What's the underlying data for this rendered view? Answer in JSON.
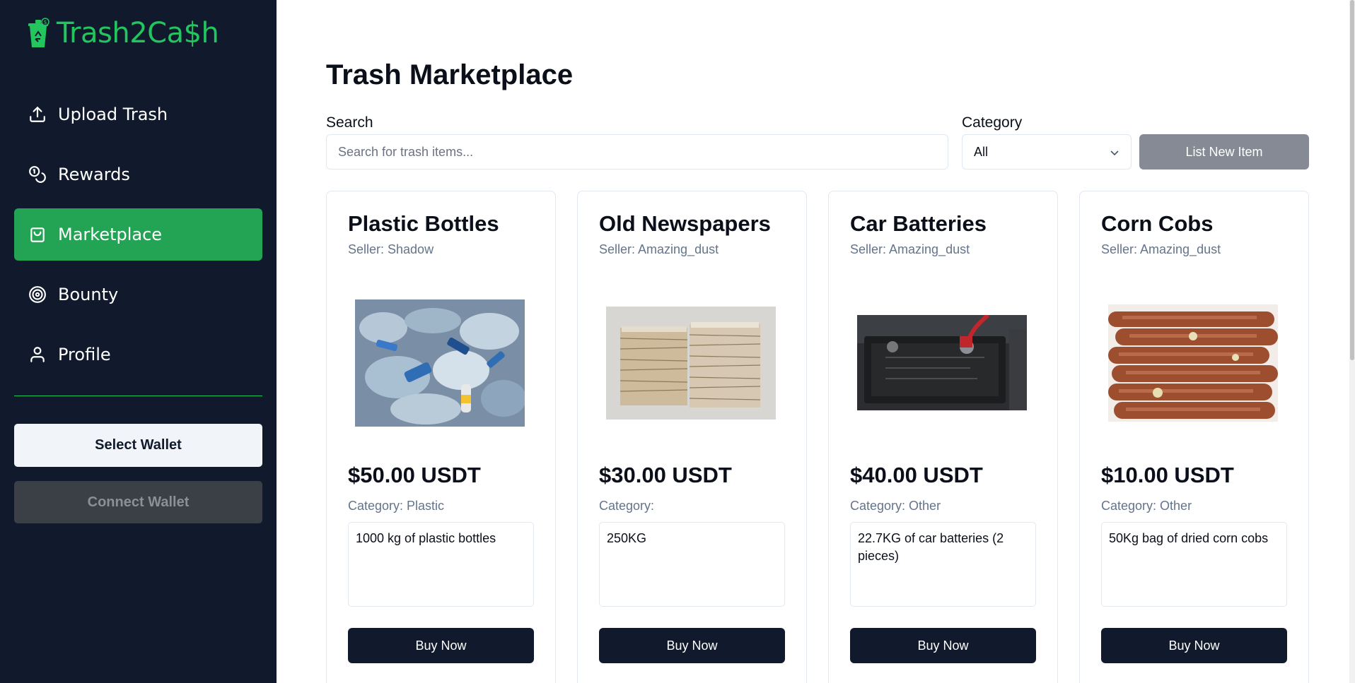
{
  "sidebar": {
    "brand": "Trash2Ca$h",
    "nav": [
      {
        "label": "Upload Trash",
        "icon": "upload-icon"
      },
      {
        "label": "Rewards",
        "icon": "coins-icon"
      },
      {
        "label": "Marketplace",
        "icon": "shopping-bag-icon",
        "active": true
      },
      {
        "label": "Bounty",
        "icon": "target-icon"
      },
      {
        "label": "Profile",
        "icon": "user-icon"
      }
    ],
    "select_wallet": "Select Wallet",
    "connect_wallet": "Connect Wallet"
  },
  "main": {
    "title": "Trash Marketplace",
    "search_label": "Search",
    "search_placeholder": "Search for trash items...",
    "search_value": "",
    "category_label": "Category",
    "category_value": "All",
    "list_button": "List New Item"
  },
  "cards": [
    {
      "title": "Plastic Bottles",
      "seller": "Seller: Shadow",
      "price": "$50.00 USDT",
      "category": "Category: Plastic",
      "description": "1000 kg of plastic bottles",
      "buy": "Buy Now",
      "image": "plastic-bottles-photo"
    },
    {
      "title": "Old Newspapers",
      "seller": "Seller: Amazing_dust",
      "price": "$30.00 USDT",
      "category": "Category:",
      "description": "250KG",
      "buy": "Buy Now",
      "image": "newspapers-photo"
    },
    {
      "title": "Car Batteries",
      "seller": "Seller: Amazing_dust",
      "price": "$40.00 USDT",
      "category": "Category: Other",
      "description": "22.7KG of car batteries (2 pieces)",
      "buy": "Buy Now",
      "image": "car-battery-photo"
    },
    {
      "title": "Corn Cobs",
      "seller": "Seller: Amazing_dust",
      "price": "$10.00 USDT",
      "category": "Category: Other",
      "description": "50Kg bag of dried corn cobs",
      "buy": "Buy Now",
      "image": "corn-cobs-photo"
    }
  ],
  "colors": {
    "sidebar_bg": "#111a2c",
    "accent_green": "#22c55e",
    "active_nav": "#22a454",
    "buy_button": "#111a2c"
  }
}
